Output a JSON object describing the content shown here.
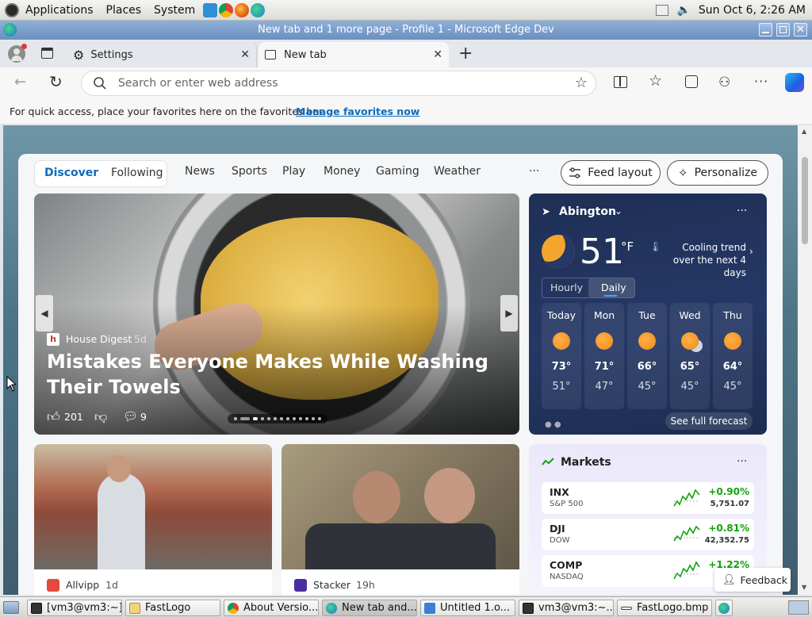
{
  "panel": {
    "menus": [
      "Applications",
      "Places",
      "System"
    ],
    "clock": "Sun Oct  6,  2:26 AM"
  },
  "window": {
    "title": "New tab and 1 more page - Profile 1 - Microsoft Edge Dev"
  },
  "tabs": [
    {
      "label": "Settings",
      "icon": "gear-icon"
    },
    {
      "label": "New tab",
      "icon": "newtab-icon"
    }
  ],
  "omnibox": {
    "placeholder": "Search or enter web address"
  },
  "favorites_bar": {
    "text": "For quick access, place your favorites here on the favorites bar.",
    "link": "Manage favorites now"
  },
  "feed": {
    "tabs": [
      "Discover",
      "Following"
    ],
    "nav": [
      "News",
      "Sports",
      "Play",
      "Money",
      "Gaming",
      "Weather"
    ],
    "more": "···",
    "feed_layout": "Feed layout",
    "personalize": "Personalize"
  },
  "hero": {
    "source": "House Digest",
    "age": "5d",
    "headline": "Mistakes Everyone Makes While Washing Their Towels",
    "likes": "201",
    "comments": "9"
  },
  "weather": {
    "location": "Abington",
    "temp": "51",
    "unit": "°F",
    "trend": "Cooling trend over the next 4 days",
    "toggle": [
      "Hourly",
      "Daily"
    ],
    "days": [
      {
        "day": "Today",
        "hi": "73°",
        "lo": "51°"
      },
      {
        "day": "Mon",
        "hi": "71°",
        "lo": "47°"
      },
      {
        "day": "Tue",
        "hi": "66°",
        "lo": "45°"
      },
      {
        "day": "Wed",
        "hi": "65°",
        "lo": "45°"
      },
      {
        "day": "Thu",
        "hi": "64°",
        "lo": "45°"
      }
    ],
    "forecast_link": "See full forecast"
  },
  "cards": [
    {
      "source": "Allvipp",
      "age": "1d"
    },
    {
      "source": "Stacker",
      "age": "19h"
    }
  ],
  "markets": {
    "title": "Markets",
    "rows": [
      {
        "symbol": "INX",
        "name": "S&P 500",
        "change": "+0.90%",
        "value": "5,751.07"
      },
      {
        "symbol": "DJI",
        "name": "DOW",
        "change": "+0.81%",
        "value": "42,352.75"
      },
      {
        "symbol": "COMP",
        "name": "NASDAQ",
        "change": "+1.22%",
        "value": ""
      }
    ],
    "feedback": "Feedback"
  },
  "taskbar": [
    {
      "label": "[vm3@vm3:~]"
    },
    {
      "label": "FastLogo"
    },
    {
      "label": "About Versio..."
    },
    {
      "label": "New tab and..."
    },
    {
      "label": "Untitled 1.o..."
    },
    {
      "label": "vm3@vm3:~..."
    },
    {
      "label": "FastLogo.bmp"
    }
  ],
  "colors": {
    "accent": "#0f6cbd",
    "positive": "#13a10e",
    "link": "#0f6cbd"
  }
}
